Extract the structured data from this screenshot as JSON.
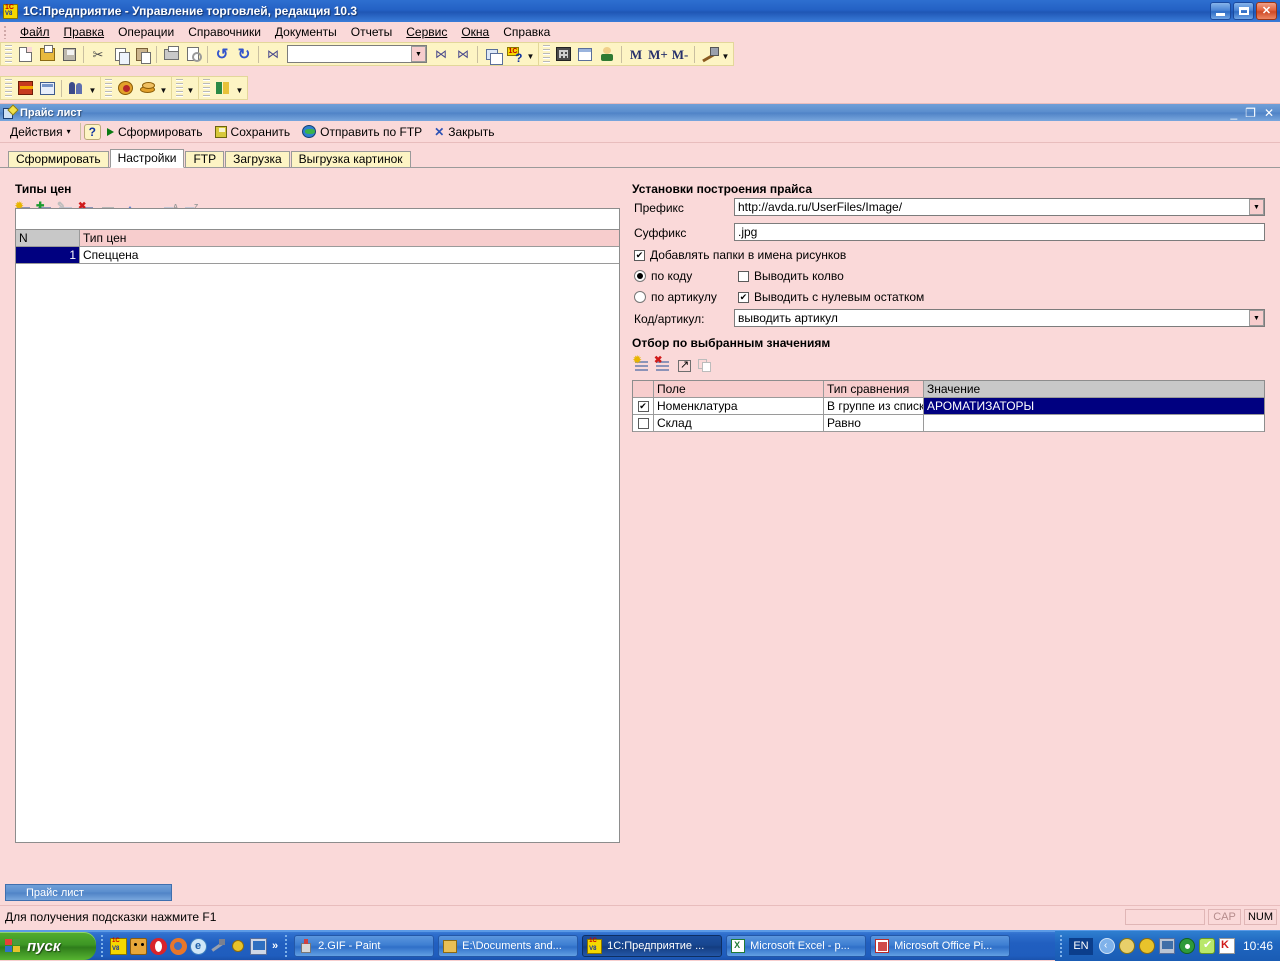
{
  "window": {
    "title": "1С:Предприятие - Управление торговлей, редакция 10.3",
    "logo_icon": "1c-v8-logo-icon",
    "minimize_label": "_",
    "maximize_label": "□",
    "close_label": "✕"
  },
  "menu": {
    "items": [
      {
        "label": "Файл"
      },
      {
        "label": "Правка"
      },
      {
        "label": "Операции"
      },
      {
        "label": "Справочники"
      },
      {
        "label": "Документы"
      },
      {
        "label": "Отчеты"
      },
      {
        "label": "Сервис"
      },
      {
        "label": "Окна"
      },
      {
        "label": "Справка"
      }
    ]
  },
  "toolbar_main": {
    "search_value": "",
    "search_placeholder": "",
    "memory_buttons": [
      "M",
      "M+",
      "M-"
    ]
  },
  "child_window": {
    "title": "Прайс лист",
    "icon": "report-window-icon",
    "minimize_label": "_",
    "restore_label": "❐",
    "close_label": "✕"
  },
  "action_bar": {
    "actions_label": "Действия",
    "actions_caret": "▾",
    "help_label": "?",
    "generate_label": "Сформировать",
    "save_label": "Сохранить",
    "send_ftp_label": "Отправить по FTP",
    "close_label": "Закрыть"
  },
  "tabs": [
    {
      "label": "Сформировать",
      "active": false
    },
    {
      "label": "Настройки",
      "active": true
    },
    {
      "label": "FTP",
      "active": false
    },
    {
      "label": "Загрузка",
      "active": false
    },
    {
      "label": "Выгрузка картинок",
      "active": false
    }
  ],
  "price_types": {
    "title": "Типы цен",
    "toolbar_icons": [
      "add-row-icon",
      "add-copy-row-icon",
      "edit-row-icon",
      "delete-row-icon",
      "save-row-icon",
      "move-up-icon",
      "move-down-icon",
      "sort-asc-icon",
      "sort-desc-icon"
    ],
    "columns": [
      "N",
      "Тип цен"
    ],
    "rows": [
      {
        "n": "1",
        "name": "Спеццена",
        "selected": true
      }
    ]
  },
  "price_settings": {
    "title": "Установки построения прайса",
    "prefix_label": "Префикс",
    "prefix_value": "http://avda.ru/UserFiles/Image/",
    "suffix_label": "Суффикс",
    "suffix_value": ".jpg",
    "add_folders_label": "Добавлять папки в имена рисунков",
    "add_folders_checked": true,
    "by_code_label": "по коду",
    "by_code_selected": true,
    "by_article_label": "по артикулу",
    "by_article_selected": false,
    "show_qty_label": "Выводить колво",
    "show_qty_checked": false,
    "show_zero_label": "Выводить с нулевым остатком",
    "show_zero_checked": true,
    "code_article_label": "Код/артикул:",
    "code_article_value": "выводить артикул"
  },
  "filter": {
    "title": "Отбор по выбранным значениям",
    "toolbar_icons": [
      "add-filter-icon",
      "delete-filter-icon",
      "edit-filter-icon",
      "copy-filter-icon"
    ],
    "columns": [
      "",
      "Поле",
      "Тип сравнения",
      "Значение"
    ],
    "rows": [
      {
        "checked": true,
        "field": "Номенклатура",
        "comparison": "В группе из списка",
        "value": "АРОМАТИЗАТОРЫ",
        "value_selected": true
      },
      {
        "checked": false,
        "field": "Склад",
        "comparison": "Равно",
        "value": "",
        "value_selected": false
      }
    ]
  },
  "window_list": [
    {
      "label": "Прайс лист",
      "active": true
    }
  ],
  "status_bar": {
    "hint": "Для получения подсказки нажмите F1",
    "caps_label": "CAP",
    "num_label": "NUM"
  },
  "taskbar": {
    "start_label": "пуск",
    "quick_launch": [
      "1c-icon",
      "tomato-face-icon",
      "opera-icon",
      "firefox-icon",
      "internet-explorer-icon",
      "tool-icon",
      "yellow-net-icon",
      "desktop-icon"
    ],
    "quick_launch_more": "»",
    "tasks": [
      {
        "label": "2.GIF - Paint",
        "icon": "paint-icon",
        "active": false
      },
      {
        "label": "E:\\Documents and...",
        "icon": "folder-icon",
        "active": false
      },
      {
        "label": "1С:Предприятие ...",
        "icon": "1c-icon",
        "active": true
      },
      {
        "label": "Microsoft Excel - p...",
        "icon": "excel-icon",
        "active": false
      },
      {
        "label": "Microsoft Office Pi...",
        "icon": "picture-manager-icon",
        "active": false
      }
    ],
    "language": "EN",
    "tray_icons": [
      "back-arrow-icon",
      "clock-icon",
      "net-icon",
      "monitor-icon",
      "target-icon",
      "shield-check-icon",
      "kaspersky-icon"
    ],
    "clock": "10:46"
  },
  "colors": {
    "accent": "#f7cdcd",
    "titlebar": "#2461c4",
    "selection": "#000080",
    "toolbar_yellow": "#fdf4c4",
    "taskbar": "#215fc0"
  }
}
